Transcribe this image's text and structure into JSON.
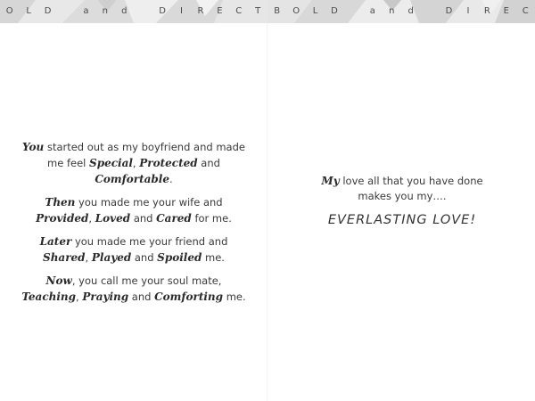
{
  "banner": {
    "left_letters": [
      "O",
      "L",
      "D",
      "",
      "a",
      "n",
      "d",
      "",
      "D",
      "I",
      "R",
      "E",
      "C",
      "T"
    ],
    "right_letters": [
      "B",
      "O",
      "L",
      "D",
      "",
      "a",
      "n",
      "d",
      "",
      "D",
      "I",
      "R",
      "E",
      "C"
    ]
  },
  "poem": {
    "stanza1": {
      "w1": "You",
      "t1": " started out as my boyfriend and made me feel ",
      "w2": "Special",
      "t2": ", ",
      "w3": "Protected",
      "t3": " and ",
      "w4": "Comfortable",
      "t4": "."
    },
    "stanza2": {
      "w1": "Then",
      "t1": " you made me your wife and ",
      "w2": "Provided",
      "t2": ", ",
      "w3": "Loved",
      "t3": " and ",
      "w4": "Cared",
      "t4": " for me."
    },
    "stanza3": {
      "w1": "Later",
      "t1": " you made me your friend and ",
      "w2": "Shared",
      "t2": ", ",
      "w3": "Played",
      "t3": " and ",
      "w4": "Spoiled",
      "t4": " me."
    },
    "stanza4": {
      "w1": "Now",
      "t1": ", you call me your soul mate, ",
      "w2": "Teaching",
      "t2": ", ",
      "w3": "Praying",
      "t3": " and ",
      "w4": "Comforting",
      "t4": " me."
    }
  },
  "closing": {
    "w1": "My",
    "t1": " love all that you have done makes you my….",
    "headline": "EVERLASTING LOVE!"
  }
}
